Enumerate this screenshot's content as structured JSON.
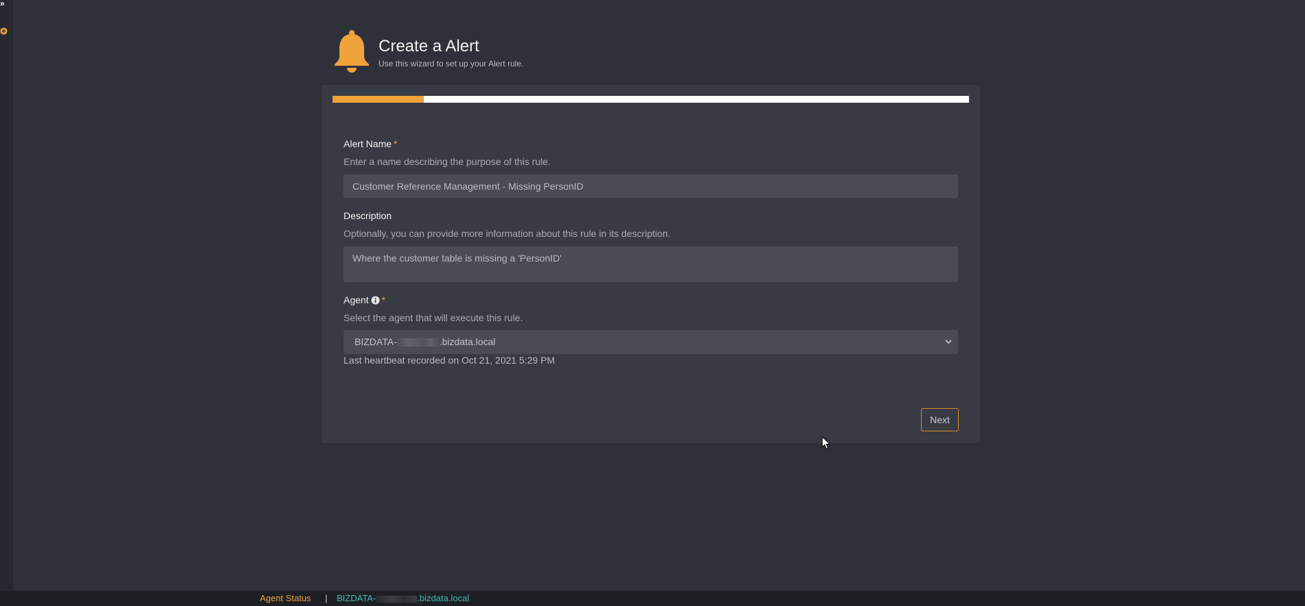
{
  "header": {
    "title": "Create a Alert",
    "subtitle": "Use this wizard to set up your Alert rule."
  },
  "progress": {
    "fraction": 0.143
  },
  "fields": {
    "alert_name": {
      "label": "Alert Name",
      "required_mark": "*",
      "help": "Enter a name describing the purpose of this rule.",
      "value": "Customer Reference Management - Missing PersonID"
    },
    "description": {
      "label": "Description",
      "help": "Optionally, you can provide more information about this rule in its description.",
      "value": "Where the customer table is missing a 'PersonID'"
    },
    "agent": {
      "label": "Agent",
      "required_mark": "*",
      "help": "Select the agent that will execute this rule.",
      "selected_prefix": "BIZDATA-",
      "selected_suffix": ".bizdata.local",
      "heartbeat": "Last heartbeat recorded on Oct 21, 2021 5:29 PM"
    }
  },
  "buttons": {
    "next": "Next"
  },
  "statusbar": {
    "label": "Agent Status",
    "separator": "|",
    "agent_prefix": "BIZDATA-",
    "agent_suffix": ".bizdata.local"
  },
  "colors": {
    "accent": "#f0a33b",
    "background": "#2f313a",
    "panel": "#393b44",
    "status_agent": "#3ec0b3"
  },
  "icons": {
    "sidebar_expand": "double-chevron-right-icon",
    "sidebar_add": "plus-circle-icon",
    "header": "bell-icon",
    "agent_info": "info-icon",
    "select": "chevron-down-icon"
  }
}
